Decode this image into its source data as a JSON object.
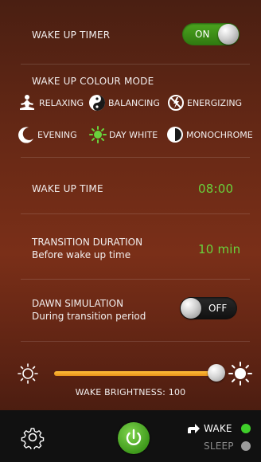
{
  "wake_timer": {
    "label": "WAKE UP TIMER",
    "toggle": "ON"
  },
  "colour_mode": {
    "label": "WAKE UP COLOUR MODE",
    "modes": [
      {
        "label": "RELAXING",
        "icon": "meditation-icon"
      },
      {
        "label": "BALANCING",
        "icon": "yin-yang-icon"
      },
      {
        "label": "ENERGIZING",
        "icon": "energy-icon"
      },
      {
        "label": "EVENING",
        "icon": "moon-icon"
      },
      {
        "label": "DAY WHITE",
        "icon": "sun-icon",
        "selected": true
      },
      {
        "label": "MONOCHROME",
        "icon": "half-circle-icon"
      }
    ]
  },
  "wake_time": {
    "label": "WAKE UP TIME",
    "value": "08:00"
  },
  "transition": {
    "label": "TRANSITION DURATION",
    "sub": "Before wake up time",
    "value": "10 min"
  },
  "dawn": {
    "label": "DAWN SIMULATION",
    "sub": "During transition period",
    "toggle": "OFF"
  },
  "brightness": {
    "label": "WAKE BRIGHTNESS: 100",
    "value": 100
  },
  "bottom": {
    "wake": "WAKE",
    "sleep": "SLEEP"
  },
  "colors": {
    "accent": "#69d23c",
    "slider": "#f2a526"
  }
}
